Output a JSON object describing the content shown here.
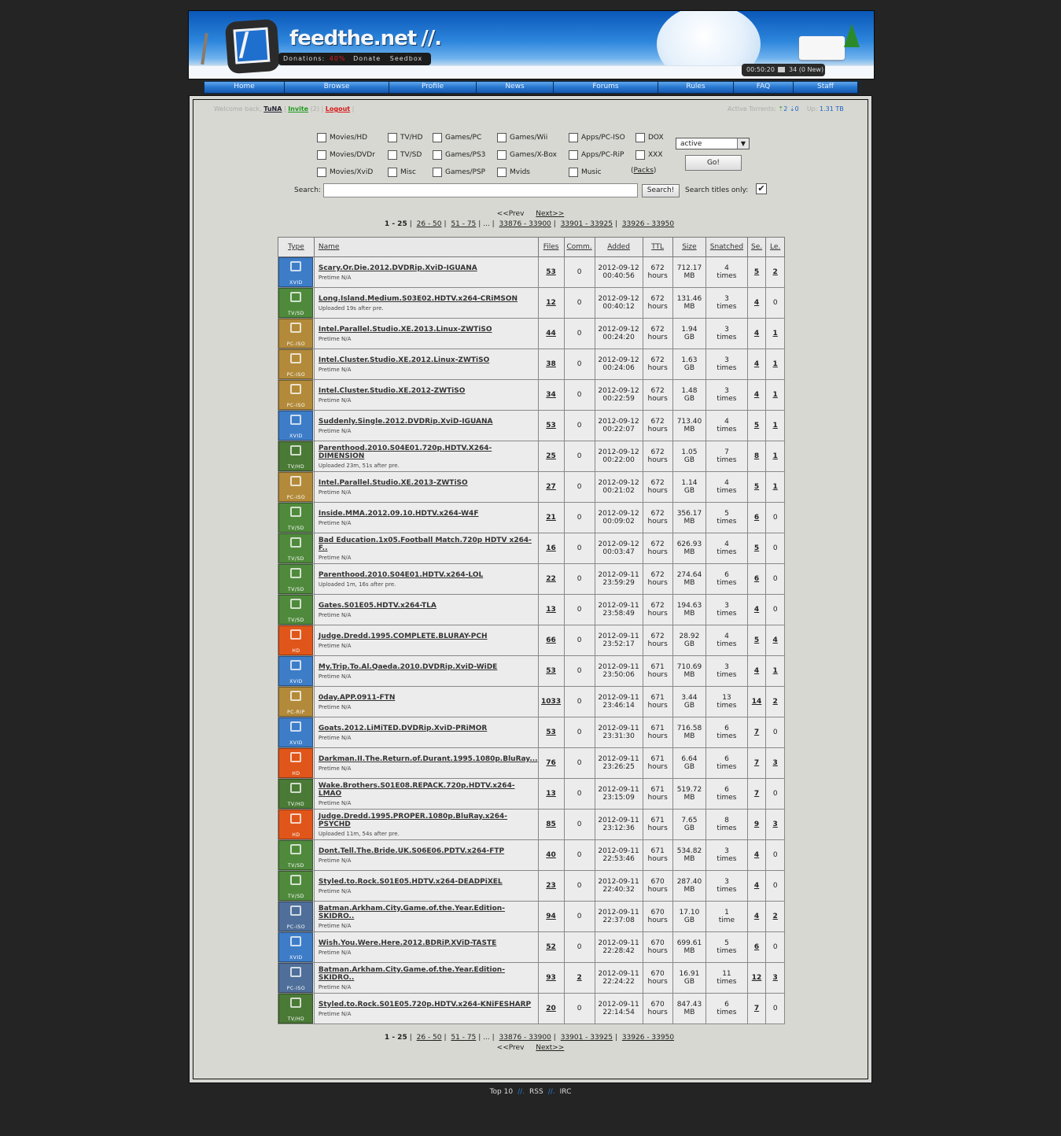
{
  "header": {
    "site_title": "feedthe.net",
    "title_slashes": "//.",
    "donations_label": "Donations:",
    "donations_pct": "40%",
    "donate_link": "Donate",
    "seedbox_link": "Seedbox",
    "clock": "00:50:20",
    "messages": "34 (0 New)"
  },
  "nav": [
    "Home",
    "Browse",
    "Profile",
    "News",
    "Forums",
    "Rules",
    "FAQ",
    "Staff"
  ],
  "userbar": {
    "welcome": "Welcome back,",
    "username": "TuNA",
    "invite": "Invite",
    "invite_count": "(2)",
    "logout": "Logout",
    "active_label": "Active Torrents:",
    "seeding": "2",
    "leeching": "0",
    "up_label": "Up:",
    "up_value": "1.31 TB"
  },
  "filters": {
    "categories": [
      [
        "Movies/HD",
        "TV/HD",
        "Games/PC",
        "Games/Wii",
        "Apps/PC-ISO",
        "DOX"
      ],
      [
        "Movies/DVDr",
        "TV/SD",
        "Games/PS3",
        "Games/X-Box",
        "Apps/PC-RiP",
        "XXX"
      ],
      [
        "Movies/XviD",
        "Misc",
        "Games/PSP",
        "Mvids",
        "Music",
        ""
      ]
    ],
    "packs": "(Packs)",
    "status_value": "active",
    "go": "Go!",
    "search_label": "Search:",
    "search_value": "",
    "search_button": "Search!",
    "titles_only_label": "Search titles only:",
    "titles_only_checked": "✔"
  },
  "pagination": {
    "prev": "<<Prev",
    "next": "Next>>",
    "current": "1 - 25",
    "pages": [
      "26 - 50",
      "51 - 75"
    ],
    "ellipsis": "...",
    "tail": [
      "33876 - 33900",
      "33901 - 33925",
      "33926 - 33950"
    ]
  },
  "table": {
    "headers": [
      "Type",
      "Name",
      "Files",
      "Comm.",
      "Added",
      "TTL",
      "Size",
      "Snatched",
      "Se.",
      "Le."
    ],
    "type_colors": {
      "XVID": "#3d7dc8",
      "TV/SD": "#4f8a3c",
      "TV/HD": "#4a7a36",
      "PC-ISO": "#b28a3a",
      "PC-RIP": "#b28a3a",
      "HD": "#e0561a",
      "GAME": "#4f6f9a"
    },
    "rows": [
      {
        "type": "XVID",
        "icon": "film-icon",
        "name": "Scary.Or.Die.2012.DVDRip.XviD-IGUANA",
        "sub": "Pretime N/A",
        "files": "53",
        "comm": "0",
        "date": "2012-09-12",
        "time": "00:40:56",
        "ttl": "672",
        "ttl_unit": "hours",
        "size": "712.17",
        "size_unit": "MB",
        "snatched": "4",
        "snatched_unit": "times",
        "se": "5",
        "le": "2",
        "le_link": true
      },
      {
        "type": "TV/SD",
        "icon": "tv-icon",
        "name": "Long.Island.Medium.S03E02.HDTV.x264-CRiMSON",
        "sub": "Uploaded 19s after pre.",
        "files": "12",
        "comm": "0",
        "date": "2012-09-12",
        "time": "00:40:12",
        "ttl": "672",
        "ttl_unit": "hours",
        "size": "131.46",
        "size_unit": "MB",
        "snatched": "3",
        "snatched_unit": "times",
        "se": "4",
        "le": "0",
        "le_link": false
      },
      {
        "type": "PC-ISO",
        "icon": "windows-icon",
        "name": "Intel.Parallel.Studio.XE.2013.Linux-ZWTiSO",
        "sub": "Pretime N/A",
        "files": "44",
        "comm": "0",
        "date": "2012-09-12",
        "time": "00:24:20",
        "ttl": "672",
        "ttl_unit": "hours",
        "size": "1.94",
        "size_unit": "GB",
        "snatched": "3",
        "snatched_unit": "times",
        "se": "4",
        "le": "1",
        "le_link": true
      },
      {
        "type": "PC-ISO",
        "icon": "windows-icon",
        "name": "Intel.Cluster.Studio.XE.2012.Linux-ZWTiSO",
        "sub": "Pretime N/A",
        "files": "38",
        "comm": "0",
        "date": "2012-09-12",
        "time": "00:24:06",
        "ttl": "672",
        "ttl_unit": "hours",
        "size": "1.63",
        "size_unit": "GB",
        "snatched": "3",
        "snatched_unit": "times",
        "se": "4",
        "le": "1",
        "le_link": true
      },
      {
        "type": "PC-ISO",
        "icon": "windows-icon",
        "name": "Intel.Cluster.Studio.XE.2012-ZWTiSO",
        "sub": "Pretime N/A",
        "files": "34",
        "comm": "0",
        "date": "2012-09-12",
        "time": "00:22:59",
        "ttl": "672",
        "ttl_unit": "hours",
        "size": "1.48",
        "size_unit": "GB",
        "snatched": "3",
        "snatched_unit": "times",
        "se": "4",
        "le": "1",
        "le_link": true
      },
      {
        "type": "XVID",
        "icon": "film-icon",
        "name": "Suddenly.Single.2012.DVDRip.XviD-IGUANA",
        "sub": "Pretime N/A",
        "files": "53",
        "comm": "0",
        "date": "2012-09-12",
        "time": "00:22:07",
        "ttl": "672",
        "ttl_unit": "hours",
        "size": "713.40",
        "size_unit": "MB",
        "snatched": "4",
        "snatched_unit": "times",
        "se": "5",
        "le": "1",
        "le_link": true
      },
      {
        "type": "TV/HD",
        "icon": "tv-icon",
        "name": "Parenthood.2010.S04E01.720p.HDTV.X264-DIMENSION",
        "sub": "Uploaded 23m, 51s after pre.",
        "files": "25",
        "comm": "0",
        "date": "2012-09-12",
        "time": "00:22:00",
        "ttl": "672",
        "ttl_unit": "hours",
        "size": "1.05",
        "size_unit": "GB",
        "snatched": "7",
        "snatched_unit": "times",
        "se": "8",
        "le": "1",
        "le_link": true
      },
      {
        "type": "PC-ISO",
        "icon": "windows-icon",
        "name": "Intel.Parallel.Studio.XE.2013-ZWTiSO",
        "sub": "Pretime N/A",
        "files": "27",
        "comm": "0",
        "date": "2012-09-12",
        "time": "00:21:02",
        "ttl": "672",
        "ttl_unit": "hours",
        "size": "1.14",
        "size_unit": "GB",
        "snatched": "4",
        "snatched_unit": "times",
        "se": "5",
        "le": "1",
        "le_link": true
      },
      {
        "type": "TV/SD",
        "icon": "tv-icon",
        "name": "Inside.MMA.2012.09.10.HDTV.x264-W4F",
        "sub": "Pretime N/A",
        "files": "21",
        "comm": "0",
        "date": "2012-09-12",
        "time": "00:09:02",
        "ttl": "672",
        "ttl_unit": "hours",
        "size": "356.17",
        "size_unit": "MB",
        "snatched": "5",
        "snatched_unit": "times",
        "se": "6",
        "le": "0",
        "le_link": false
      },
      {
        "type": "TV/SD",
        "icon": "tv-icon",
        "name": "Bad Education.1x05.Football Match.720p HDTV x264-F..",
        "sub": "Pretime N/A",
        "files": "16",
        "comm": "0",
        "date": "2012-09-12",
        "time": "00:03:47",
        "ttl": "672",
        "ttl_unit": "hours",
        "size": "626.93",
        "size_unit": "MB",
        "snatched": "4",
        "snatched_unit": "times",
        "se": "5",
        "le": "0",
        "le_link": false
      },
      {
        "type": "TV/SD",
        "icon": "tv-icon",
        "name": "Parenthood.2010.S04E01.HDTV.x264-LOL",
        "sub": "Uploaded 1m, 16s after pre.",
        "files": "22",
        "comm": "0",
        "date": "2012-09-11",
        "time": "23:59:29",
        "ttl": "672",
        "ttl_unit": "hours",
        "size": "274.64",
        "size_unit": "MB",
        "snatched": "6",
        "snatched_unit": "times",
        "se": "6",
        "le": "0",
        "le_link": false
      },
      {
        "type": "TV/SD",
        "icon": "tv-icon",
        "name": "Gates.S01E05.HDTV.x264-TLA",
        "sub": "Pretime N/A",
        "files": "13",
        "comm": "0",
        "date": "2012-09-11",
        "time": "23:58:49",
        "ttl": "672",
        "ttl_unit": "hours",
        "size": "194.63",
        "size_unit": "MB",
        "snatched": "3",
        "snatched_unit": "times",
        "se": "4",
        "le": "0",
        "le_link": false
      },
      {
        "type": "HD",
        "icon": "film-icon",
        "name": "Judge.Dredd.1995.COMPLETE.BLURAY-PCH",
        "sub": "Pretime N/A",
        "files": "66",
        "comm": "0",
        "date": "2012-09-11",
        "time": "23:52:17",
        "ttl": "672",
        "ttl_unit": "hours",
        "size": "28.92",
        "size_unit": "GB",
        "snatched": "4",
        "snatched_unit": "times",
        "se": "5",
        "le": "4",
        "le_link": true
      },
      {
        "type": "XVID",
        "icon": "film-icon",
        "name": "My.Trip.To.Al.Qaeda.2010.DVDRip.XviD-WiDE",
        "sub": "Pretime N/A",
        "files": "53",
        "comm": "0",
        "date": "2012-09-11",
        "time": "23:50:06",
        "ttl": "671",
        "ttl_unit": "hours",
        "size": "710.69",
        "size_unit": "MB",
        "snatched": "3",
        "snatched_unit": "times",
        "se": "4",
        "le": "1",
        "le_link": true
      },
      {
        "type": "PC-RIP",
        "icon": "windows-icon",
        "name": "0day.APP.0911-FTN",
        "sub": "Pretime N/A",
        "files": "1033",
        "comm": "0",
        "date": "2012-09-11",
        "time": "23:46:14",
        "ttl": "671",
        "ttl_unit": "hours",
        "size": "3.44",
        "size_unit": "GB",
        "snatched": "13",
        "snatched_unit": "times",
        "se": "14",
        "le": "2",
        "le_link": true
      },
      {
        "type": "XVID",
        "icon": "film-icon",
        "name": "Goats.2012.LiMiTED.DVDRip.XviD-PRiMOR",
        "sub": "Pretime N/A",
        "files": "53",
        "comm": "0",
        "date": "2012-09-11",
        "time": "23:31:30",
        "ttl": "671",
        "ttl_unit": "hours",
        "size": "716.58",
        "size_unit": "MB",
        "snatched": "6",
        "snatched_unit": "times",
        "se": "7",
        "le": "0",
        "le_link": false
      },
      {
        "type": "HD",
        "icon": "film-icon",
        "name": "Darkman.II.The.Return.of.Durant.1995.1080p.BluRay...",
        "sub": "Pretime N/A",
        "files": "76",
        "comm": "0",
        "date": "2012-09-11",
        "time": "23:26:25",
        "ttl": "671",
        "ttl_unit": "hours",
        "size": "6.64",
        "size_unit": "GB",
        "snatched": "6",
        "snatched_unit": "times",
        "se": "7",
        "le": "3",
        "le_link": true
      },
      {
        "type": "TV/HD",
        "icon": "tv-icon",
        "name": "Wake.Brothers.S01E08.REPACK.720p.HDTV.x264-LMAO",
        "sub": "Pretime N/A",
        "files": "13",
        "comm": "0",
        "date": "2012-09-11",
        "time": "23:15:09",
        "ttl": "671",
        "ttl_unit": "hours",
        "size": "519.72",
        "size_unit": "MB",
        "snatched": "6",
        "snatched_unit": "times",
        "se": "7",
        "le": "0",
        "le_link": false
      },
      {
        "type": "HD",
        "icon": "film-icon",
        "name": "Judge.Dredd.1995.PROPER.1080p.BluRay.x264-PSYCHD",
        "sub": "Uploaded 11m, 54s after pre.",
        "files": "85",
        "comm": "0",
        "date": "2012-09-11",
        "time": "23:12:36",
        "ttl": "671",
        "ttl_unit": "hours",
        "size": "7.65",
        "size_unit": "GB",
        "snatched": "8",
        "snatched_unit": "times",
        "se": "9",
        "le": "3",
        "le_link": true
      },
      {
        "type": "TV/SD",
        "icon": "tv-icon",
        "name": "Dont.Tell.The.Bride.UK.S06E06.PDTV.x264-FTP",
        "sub": "Pretime N/A",
        "files": "40",
        "comm": "0",
        "date": "2012-09-11",
        "time": "22:53:46",
        "ttl": "671",
        "ttl_unit": "hours",
        "size": "534.82",
        "size_unit": "MB",
        "snatched": "3",
        "snatched_unit": "times",
        "se": "4",
        "le": "0",
        "le_link": false
      },
      {
        "type": "TV/SD",
        "icon": "tv-icon",
        "name": "Styled.to.Rock.S01E05.HDTV.x264-DEADPiXEL",
        "sub": "Pretime N/A",
        "files": "23",
        "comm": "0",
        "date": "2012-09-11",
        "time": "22:40:32",
        "ttl": "670",
        "ttl_unit": "hours",
        "size": "287.40",
        "size_unit": "MB",
        "snatched": "3",
        "snatched_unit": "times",
        "se": "4",
        "le": "0",
        "le_link": false
      },
      {
        "type": "GAME",
        "icon": "gamepad-icon",
        "name": "Batman.Arkham.City.Game.of.the.Year.Edition-SKIDRO..",
        "sub": "Pretime N/A",
        "files": "94",
        "comm": "0",
        "date": "2012-09-11",
        "time": "22:37:08",
        "ttl": "670",
        "ttl_unit": "hours",
        "size": "17.10",
        "size_unit": "GB",
        "snatched": "1",
        "snatched_unit": "time",
        "se": "4",
        "le": "2",
        "le_link": true
      },
      {
        "type": "XVID",
        "icon": "film-icon",
        "name": "Wish.You.Were.Here.2012.BDRiP.XViD-TASTE",
        "sub": "Pretime N/A",
        "files": "52",
        "comm": "0",
        "date": "2012-09-11",
        "time": "22:28:42",
        "ttl": "670",
        "ttl_unit": "hours",
        "size": "699.61",
        "size_unit": "MB",
        "snatched": "5",
        "snatched_unit": "times",
        "se": "6",
        "le": "0",
        "le_link": false
      },
      {
        "type": "GAME",
        "icon": "gamepad-icon",
        "name": "Batman.Arkham.City.Game.of.the.Year.Edition-SKIDRO..",
        "sub": "Pretime N/A",
        "files": "93",
        "comm": "2",
        "comm_link": true,
        "date": "2012-09-11",
        "time": "22:24:22",
        "ttl": "670",
        "ttl_unit": "hours",
        "size": "16.91",
        "size_unit": "GB",
        "snatched": "11",
        "snatched_unit": "times",
        "se": "12",
        "le": "3",
        "le_link": true
      },
      {
        "type": "TV/HD",
        "icon": "tv-icon",
        "name": "Styled.to.Rock.S01E05.720p.HDTV.x264-KNiFESHARP",
        "sub": "Pretime N/A",
        "files": "20",
        "comm": "0",
        "date": "2012-09-11",
        "time": "22:14:54",
        "ttl": "670",
        "ttl_unit": "hours",
        "size": "847.43",
        "size_unit": "MB",
        "snatched": "6",
        "snatched_unit": "times",
        "se": "7",
        "le": "0",
        "le_link": false
      }
    ],
    "type_labels": {
      "XVID": "XVID",
      "TV/SD": "TV/SD",
      "TV/HD": "TV/HD",
      "PC-ISO": "PC-ISO",
      "PC-RIP": "PC-RIP",
      "HD": "HD",
      "GAME": "PC-ISO"
    }
  },
  "footer": {
    "links": [
      "Top 10",
      "RSS",
      "IRC"
    ],
    "sep": "//."
  }
}
